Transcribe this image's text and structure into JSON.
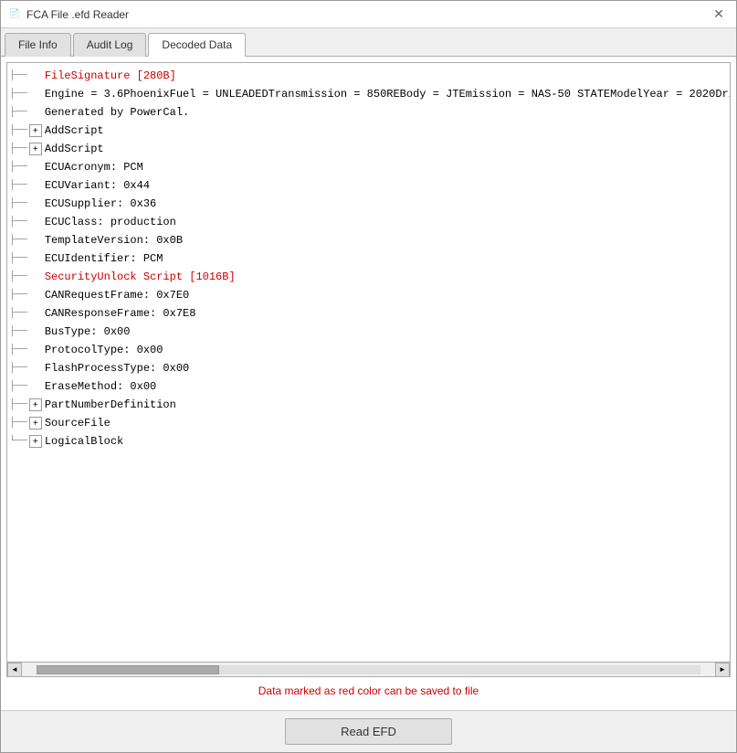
{
  "window": {
    "title": "FCA File .efd Reader",
    "close_label": "✕"
  },
  "tabs": [
    {
      "id": "file-info",
      "label": "File Info",
      "active": false
    },
    {
      "id": "audit-log",
      "label": "Audit Log",
      "active": false
    },
    {
      "id": "decoded-data",
      "label": "Decoded Data",
      "active": true
    }
  ],
  "tree": {
    "items": [
      {
        "id": "file-signature",
        "type": "red-leaf",
        "connector": "├──",
        "label": "FileSignature [280B]"
      },
      {
        "id": "engine-line",
        "type": "leaf",
        "connector": "├──",
        "label": "Engine = 3.6PhoenixFuel = UNLEADEDTransmission = 850REBody = JTEmission = NAS-50 STATEModelYear = 2020Dri"
      },
      {
        "id": "generated-line",
        "type": "leaf",
        "connector": "├──",
        "label": "Generated by PowerCal."
      },
      {
        "id": "addscript1",
        "type": "expandable",
        "connector": "├──",
        "label": "AddScript",
        "expanded": false
      },
      {
        "id": "addscript2",
        "type": "expandable",
        "connector": "├──",
        "label": "AddScript",
        "expanded": false
      },
      {
        "id": "ecu-acronym",
        "type": "leaf",
        "connector": "├──",
        "label": "ECUAcronym: PCM"
      },
      {
        "id": "ecu-variant",
        "type": "leaf",
        "connector": "├──",
        "label": "ECUVariant: 0x44"
      },
      {
        "id": "ecu-supplier",
        "type": "leaf",
        "connector": "├──",
        "label": "ECUSupplier: 0x36"
      },
      {
        "id": "ecu-class",
        "type": "leaf",
        "connector": "├──",
        "label": "ECUClass: production"
      },
      {
        "id": "template-version",
        "type": "leaf",
        "connector": "├──",
        "label": "TemplateVersion: 0x0B"
      },
      {
        "id": "ecu-identifier",
        "type": "leaf",
        "connector": "├──",
        "label": "ECUIdentifier: PCM"
      },
      {
        "id": "security-unlock",
        "type": "red-leaf",
        "connector": "├──",
        "label": "SecurityUnlock Script [1016B]"
      },
      {
        "id": "can-request",
        "type": "leaf",
        "connector": "├──",
        "label": "CANRequestFrame: 0x7E0"
      },
      {
        "id": "can-response",
        "type": "leaf",
        "connector": "├──",
        "label": "CANResponseFrame: 0x7E8"
      },
      {
        "id": "bus-type",
        "type": "leaf",
        "connector": "├──",
        "label": "BusType: 0x00"
      },
      {
        "id": "protocol-type",
        "type": "leaf",
        "connector": "├──",
        "label": "ProtocolType: 0x00"
      },
      {
        "id": "flash-process",
        "type": "leaf",
        "connector": "├──",
        "label": "FlashProcessType: 0x00"
      },
      {
        "id": "erase-method",
        "type": "leaf",
        "connector": "├──",
        "label": "EraseMethod: 0x00"
      },
      {
        "id": "part-number",
        "type": "expandable",
        "connector": "├──",
        "label": "PartNumberDefinition",
        "expanded": false
      },
      {
        "id": "source-file",
        "type": "expandable",
        "connector": "├──",
        "label": "SourceFile",
        "expanded": false
      },
      {
        "id": "logical-block",
        "type": "expandable",
        "connector": "└──",
        "label": "LogicalBlock",
        "expanded": false
      }
    ]
  },
  "status": {
    "text": "Data marked as red color can be saved to file",
    "color": "#cc0000"
  },
  "buttons": {
    "read_efd": "Read EFD"
  },
  "icons": {
    "expand": "+",
    "collapse": "-",
    "scroll_left": "◄",
    "scroll_right": "►"
  }
}
